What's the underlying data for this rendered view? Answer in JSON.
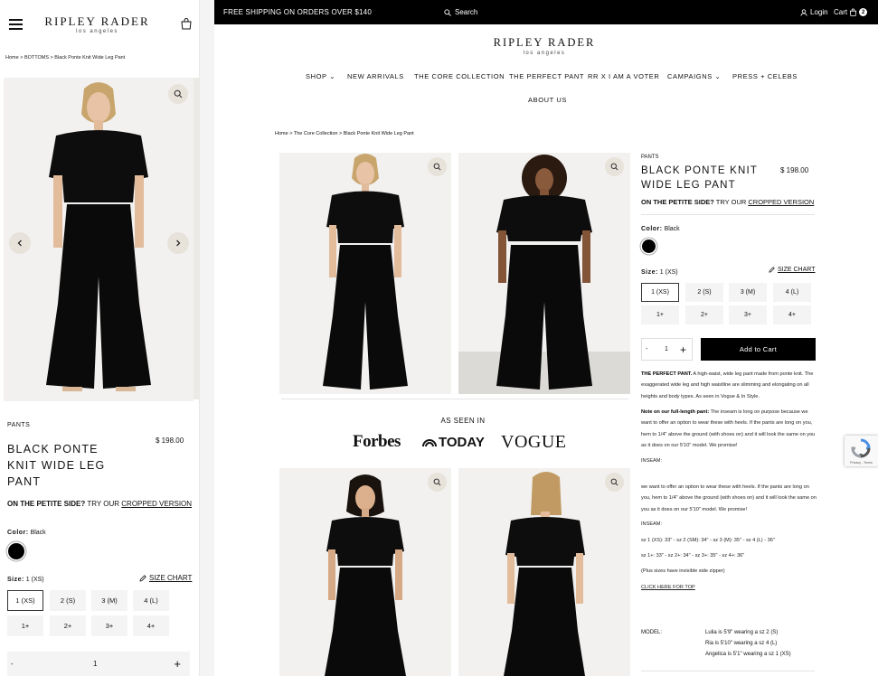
{
  "mobile": {
    "logo_main": "RIPLEY RADER",
    "logo_sub": "los angeles",
    "breadcrumb": "Home > BOTTOMS > Black Ponte Knit Wide Leg Pant",
    "category": "PANTS",
    "title": "BLACK PONTE KNIT WIDE LEG PANT",
    "price": "$ 198.00",
    "petite_bold": "ON THE PETITE SIDE?",
    "petite_try": "TRY OUR",
    "petite_link": "CROPPED VERSION",
    "color_label": "Color:",
    "color_value": "Black",
    "size_label": "Size:",
    "size_value": "1 (XS)",
    "size_chart": "SIZE CHART",
    "sizes": [
      "1 (XS)",
      "2 (S)",
      "3 (M)",
      "4 (L)",
      "1+",
      "2+",
      "3+",
      "4+"
    ],
    "qty_minus": "-",
    "qty_value": "1",
    "qty_plus": "+"
  },
  "desktop": {
    "shipping": "FREE SHIPPING ON ORDERS OVER $140",
    "search": "Search",
    "login": "Login",
    "cart": "Cart",
    "cart_count": "2",
    "logo_main": "RIPLEY RADER",
    "logo_sub": "los angeles",
    "nav": [
      "SHOP",
      "NEW ARRIVALS",
      "THE CORE COLLECTION",
      "THE PERFECT PANT",
      "RR x I AM A VOTER",
      "CAMPAIGNS",
      "PRESS + CELEBS"
    ],
    "nav_row2": "ABOUT US",
    "breadcrumb": "Home > The Core Collection > Black Ponte Knit Wide Leg Pant",
    "as_seen_in": "AS SEEN IN",
    "brands": {
      "forbes": "Forbes",
      "today": "TODAY",
      "vogue": "VOGUE"
    },
    "category": "PANTS",
    "title": "BLACK PONTE KNIT WIDE LEG PANT",
    "price": "$ 198.00",
    "petite_bold": "ON THE PETITE SIDE?",
    "petite_try": "TRY OUR",
    "petite_link": "CROPPED VERSION",
    "color_label": "Color:",
    "color_value": "Black",
    "size_label": "Size:",
    "size_value": "1 (XS)",
    "size_chart": "SIZE CHART",
    "sizes": [
      "1 (XS)",
      "2 (S)",
      "3 (M)",
      "4 (L)",
      "1+",
      "2+",
      "3+",
      "4+"
    ],
    "qty_minus": "-",
    "qty_value": "1",
    "qty_plus": "+",
    "add_to_cart": "Add to Cart",
    "desc": {
      "perfect_bold": "THE PERFECT PANT.",
      "perfect_text": " A high-waist, wide leg pant made from ponte knit. The exaggerated wide leg and high waistline are slimming and elongating on all heights and body types.  As seen in Vogue & In Style.",
      "note_bold": "Note on our full-length pant:",
      "note_text": " The inseam is long on purpose because we want to offer an option to wear these with heels.  If the pants are long on you, hem to 1/4\" above the ground (with shoes on) and it will look the same on you as it does on our 5'10\" model.  We promise!",
      "inseam1": "INSEAM:",
      "repeat_text": "we want to offer an option to wear these with heels.  If the pants are long on you, hem to 1/4\" above the ground (with shoes on) and it will look the same on you as it does on our 5'10\" model.  We promise!",
      "inseam2": "INSEAM:",
      "sizes_line1": "sz 1 (XS): 33\" - sz 2 (SM): 34\" - sz 3 (M): 35\" - sz 4 (L) - 36\"",
      "sizes_line2": "sz 1+: 33\" - sz 2+: 34\" - sz 3+: 35\" - sz 4+: 36\"",
      "zipper": "(Plus sizes have invisible side zipper)",
      "click_here": "CLICK HERE FOR TOP"
    },
    "model_label": "MODEL:",
    "models": [
      "Lulia is 5'9\" wearing a sz 2 (S)",
      "Ria is 5'10\" wearing a sz 4 (L)",
      "Angelica is 5'1\" wearing a sz 1 (XS)"
    ],
    "recaptcha": "Privacy - Terms"
  }
}
